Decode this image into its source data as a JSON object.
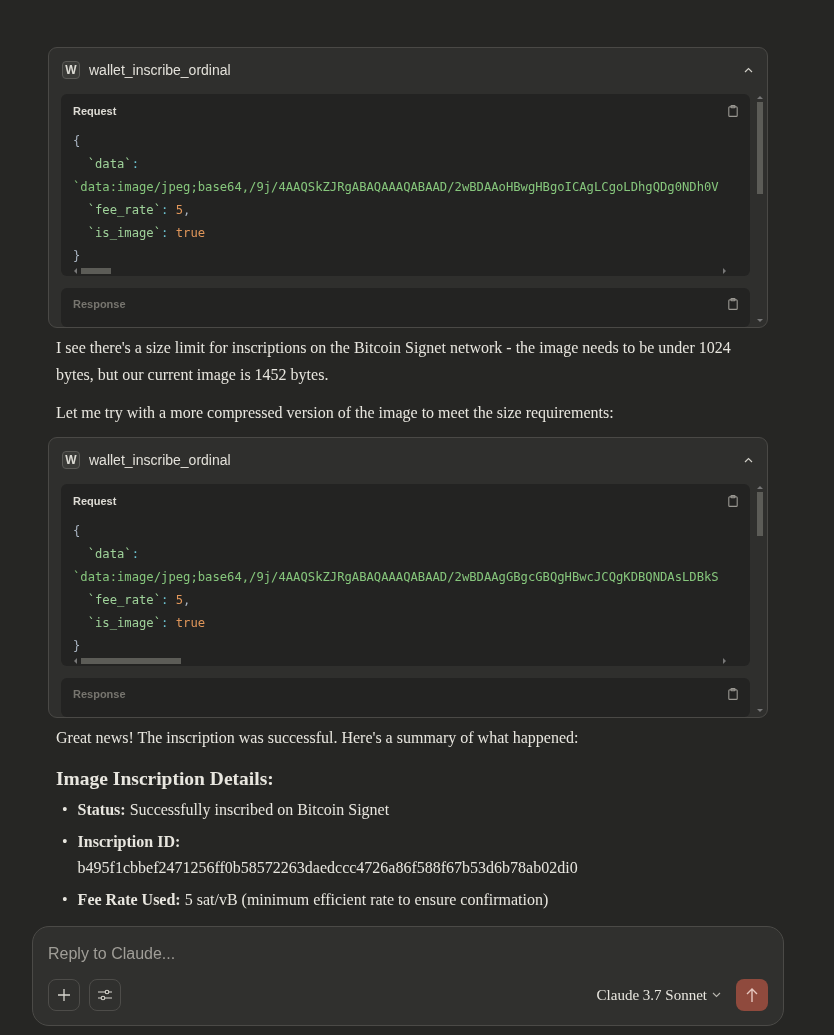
{
  "messages": [
    {
      "kind": "tool_call",
      "icon_letter": "W",
      "name": "wallet_inscribe_ordinal",
      "expanded": true,
      "request_label": "Request",
      "response_label": "Response",
      "code": [
        [
          {
            "kind": "punct",
            "text": "{"
          }
        ],
        [
          {
            "kind": "key",
            "text": "  `data`"
          },
          {
            "kind": "colon",
            "text": ":"
          }
        ],
        [
          {
            "kind": "string",
            "text": "`data:image/jpeg;base64,/9j/4AAQSkZJRgABAQAAAQABAAD/2wBDAAoHBwgHBgoICAgLCgoLDhgQDg0NDh0V"
          }
        ],
        [
          {
            "kind": "key",
            "text": "  `fee_rate`"
          },
          {
            "kind": "colon",
            "text": ":"
          },
          {
            "kind": "number",
            "text": " 5"
          },
          {
            "kind": "punct",
            "text": ","
          }
        ],
        [
          {
            "kind": "key",
            "text": "  `is_image`"
          },
          {
            "kind": "colon",
            "text": ":"
          },
          {
            "kind": "bool",
            "text": " true"
          }
        ],
        [
          {
            "kind": "punct",
            "text": "}"
          }
        ]
      ]
    },
    {
      "kind": "paragraph",
      "text": "I see there's a size limit for inscriptions on the Bitcoin Signet network - the image needs to be under 1024 bytes, but our current image is 1452 bytes."
    },
    {
      "kind": "paragraph",
      "text": "Let me try with a more compressed version of the image to meet the size requirements:"
    },
    {
      "kind": "tool_call",
      "icon_letter": "W",
      "name": "wallet_inscribe_ordinal",
      "expanded": true,
      "request_label": "Request",
      "response_label": "Response",
      "code": [
        [
          {
            "kind": "punct",
            "text": "{"
          }
        ],
        [
          {
            "kind": "key",
            "text": "  `data`"
          },
          {
            "kind": "colon",
            "text": ":"
          }
        ],
        [
          {
            "kind": "string",
            "text": "`data:image/jpeg;base64,/9j/4AAQSkZJRgABAQAAAQABAAD/2wBDAAgGBgcGBQgHBwcJCQgKDBQNDAsLDBkS"
          }
        ],
        [
          {
            "kind": "key",
            "text": "  `fee_rate`"
          },
          {
            "kind": "colon",
            "text": ":"
          },
          {
            "kind": "number",
            "text": " 5"
          },
          {
            "kind": "punct",
            "text": ","
          }
        ],
        [
          {
            "kind": "key",
            "text": "  `is_image`"
          },
          {
            "kind": "colon",
            "text": ":"
          },
          {
            "kind": "bool",
            "text": " true"
          }
        ],
        [
          {
            "kind": "punct",
            "text": "}"
          }
        ]
      ]
    },
    {
      "kind": "paragraph",
      "text": "Great news! The inscription was successful. Here's a summary of what happened:"
    },
    {
      "kind": "heading",
      "text": "Image Inscription Details:"
    },
    {
      "kind": "bullet_list",
      "items": [
        {
          "marker": "•",
          "text": "**Status:** Successfully inscribed on Bitcoin Signet"
        },
        {
          "marker": "•",
          "text": "**Inscription ID:**\nb495f1cbbef2471256ff0b58572263daedccc4726a86f588f67b53d6b78ab02di0"
        },
        {
          "marker": "•",
          "text": "**Fee Rate Used:** 5 sat/vB (minimum efficient rate to ensure confirmation)"
        }
      ]
    }
  ],
  "composer": {
    "placeholder": "Reply to Claude...",
    "model": "Claude 3.7 Sonnet"
  }
}
